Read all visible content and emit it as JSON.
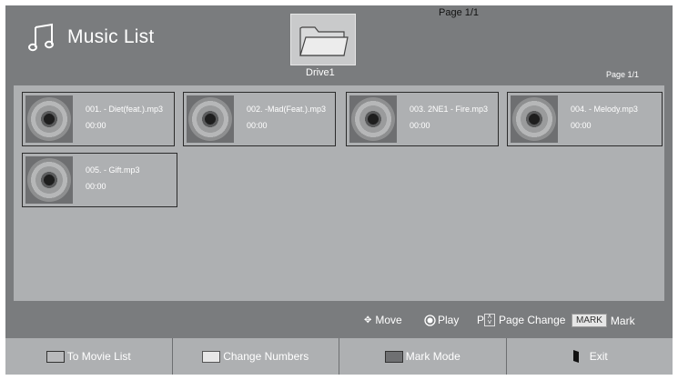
{
  "header": {
    "title": "Music List",
    "page_top": "Page 1/1",
    "drive": "Drive1",
    "page_right": "Page 1/1"
  },
  "files": [
    {
      "name": "001. - Diet(feat.).mp3",
      "time": "00:00"
    },
    {
      "name": "002. -Mad(Feat.).mp3",
      "time": "00:00"
    },
    {
      "name": "003. 2NE1 - Fire.mp3",
      "time": "00:00"
    },
    {
      "name": "004. - Melody.mp3",
      "time": "00:00"
    },
    {
      "name": "005. - Gift.mp3",
      "time": "00:00"
    }
  ],
  "help": {
    "move": "Move",
    "play": "Play",
    "p_letter": "P",
    "page_change": "Page Change",
    "mark_badge": "MARK",
    "mark": "Mark"
  },
  "buttons": [
    {
      "label": "To Movie List",
      "color": "#b9babc",
      "icon": "rect-swatch"
    },
    {
      "label": "Change Numbers",
      "color": "#e7e7e7",
      "icon": "rect-swatch"
    },
    {
      "label": "Mark Mode",
      "color": "#6f7072",
      "icon": "rect-swatch"
    },
    {
      "label": "Exit",
      "icon": "exit-door-icon"
    }
  ]
}
